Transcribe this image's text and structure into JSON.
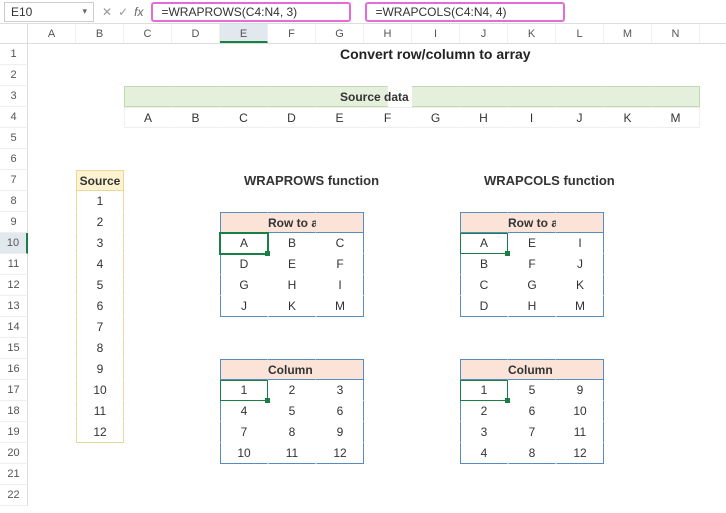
{
  "namebox": "E10",
  "fx_label": "fx",
  "formula1": "=WRAPROWS(C4:N4, 3)",
  "formula2": "=WRAPCOLS(C4:N4, 4)",
  "columns": [
    "A",
    "B",
    "C",
    "D",
    "E",
    "F",
    "G",
    "H",
    "I",
    "J",
    "K",
    "L",
    "M",
    "N"
  ],
  "rows": [
    "1",
    "2",
    "3",
    "4",
    "5",
    "6",
    "7",
    "8",
    "9",
    "10",
    "11",
    "12",
    "13",
    "14",
    "15",
    "16",
    "17",
    "18",
    "19",
    "20",
    "21",
    "22"
  ],
  "title": "Convert row/column to array",
  "source_data_label": "Source data",
  "source_row": [
    "A",
    "B",
    "C",
    "D",
    "E",
    "F",
    "G",
    "H",
    "I",
    "J",
    "K",
    "M"
  ],
  "source_col_label": "Source",
  "source_col": [
    "1",
    "2",
    "3",
    "4",
    "5",
    "6",
    "7",
    "8",
    "9",
    "10",
    "11",
    "12"
  ],
  "wraprows_label": "WRAPROWS function",
  "wrapcols_label": "WRAPCOLS function",
  "row_to_array_label": "Row to array",
  "col_to_array_label": "Column to array",
  "wraprows_row": [
    [
      "A",
      "B",
      "C"
    ],
    [
      "D",
      "E",
      "F"
    ],
    [
      "G",
      "H",
      "I"
    ],
    [
      "J",
      "K",
      "M"
    ]
  ],
  "wrapcols_row": [
    [
      "A",
      "E",
      "I"
    ],
    [
      "B",
      "F",
      "J"
    ],
    [
      "C",
      "G",
      "K"
    ],
    [
      "D",
      "H",
      "M"
    ]
  ],
  "wraprows_col": [
    [
      "1",
      "2",
      "3"
    ],
    [
      "4",
      "5",
      "6"
    ],
    [
      "7",
      "8",
      "9"
    ],
    [
      "10",
      "11",
      "12"
    ]
  ],
  "wrapcols_col": [
    [
      "1",
      "5",
      "9"
    ],
    [
      "2",
      "6",
      "10"
    ],
    [
      "3",
      "7",
      "11"
    ],
    [
      "4",
      "8",
      "12"
    ]
  ]
}
